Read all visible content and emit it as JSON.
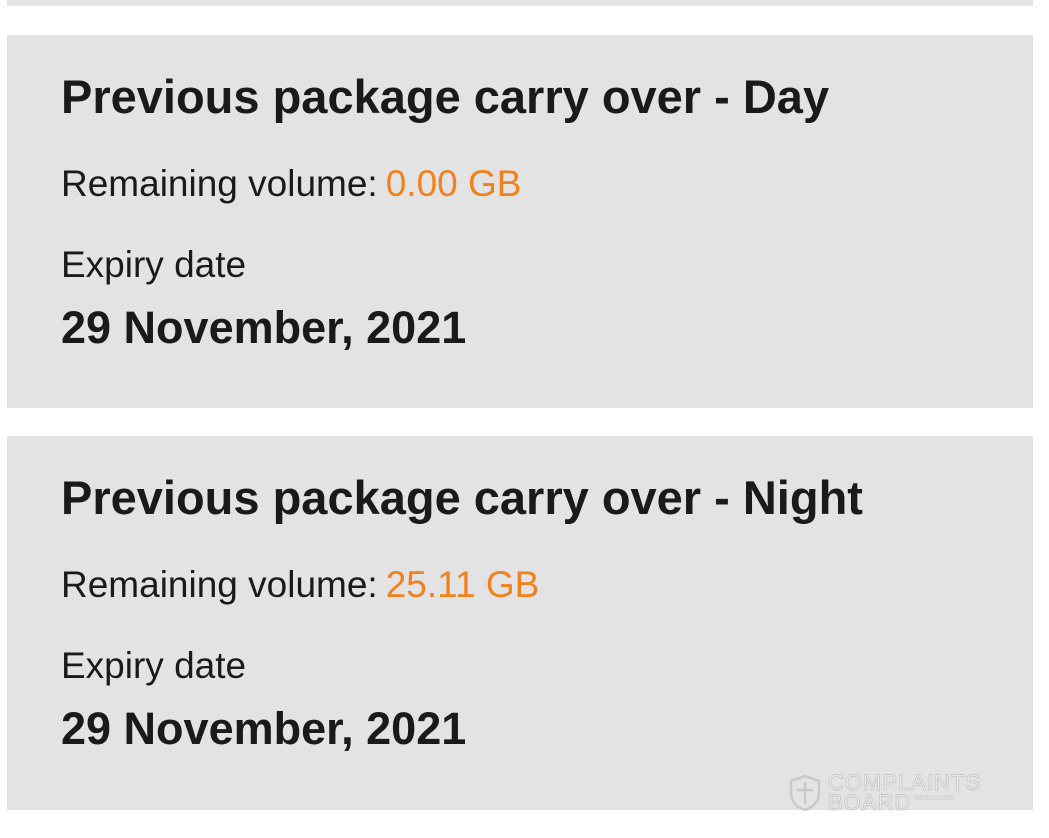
{
  "packages": [
    {
      "title": "Previous package carry over - Day",
      "volume_label": "Remaining volume:",
      "volume_value": "0.00 GB",
      "expiry_label": "Expiry date",
      "expiry_date": "29 November, 2021"
    },
    {
      "title": "Previous package carry over - Night",
      "volume_label": "Remaining volume:",
      "volume_value": "25.11 GB",
      "expiry_label": "Expiry date",
      "expiry_date": "29 November, 2021"
    }
  ],
  "watermark": {
    "line1": "COMPLAINTS",
    "line2": "BOARD",
    "tagline": "RESOLVING"
  },
  "colors": {
    "card_background": "#e3e3e3",
    "accent_volume": "#f0821e",
    "text": "#1a1a1a"
  }
}
